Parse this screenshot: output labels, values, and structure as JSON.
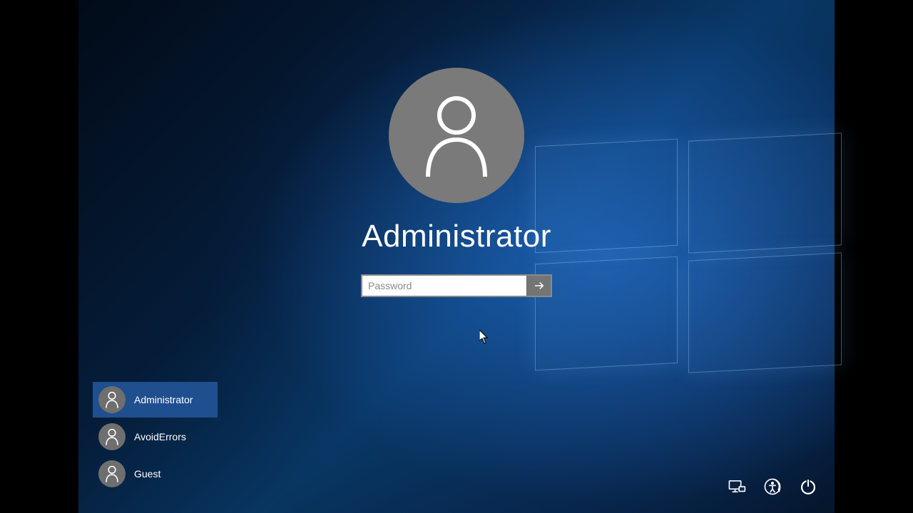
{
  "selected_user": "Administrator",
  "password_placeholder": "Password",
  "users": [
    {
      "name": "Administrator",
      "selected": true
    },
    {
      "name": "AvoidErrors",
      "selected": false
    },
    {
      "name": "Guest",
      "selected": false
    }
  ],
  "system_buttons": {
    "network": "network-icon",
    "ease_of_access": "ease-of-access-icon",
    "power": "power-icon"
  }
}
